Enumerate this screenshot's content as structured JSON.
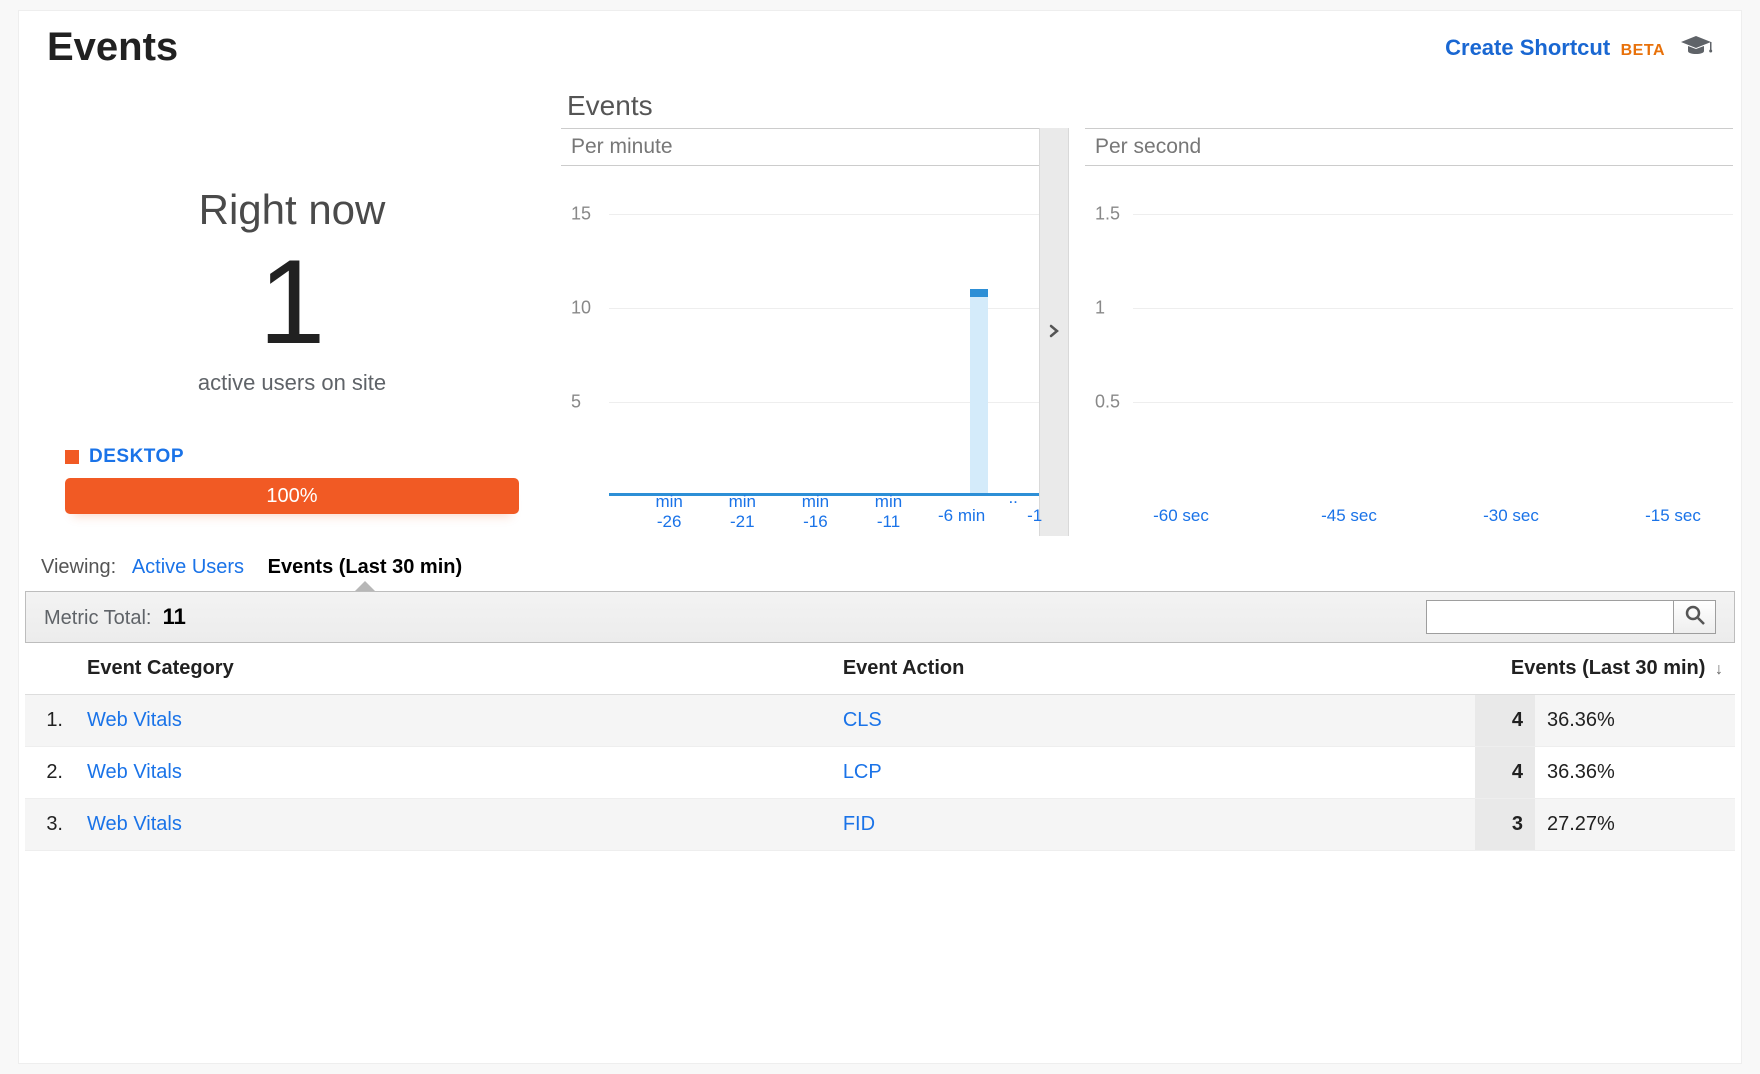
{
  "header": {
    "title": "Events",
    "shortcut_label": "Create Shortcut",
    "beta_label": "BETA"
  },
  "rightnow": {
    "title": "Right now",
    "value": "1",
    "subtitle": "active users on site",
    "device_label": "DESKTOP",
    "device_percent": "100%"
  },
  "events_section_title": "Events",
  "per_minute_label": "Per minute",
  "per_second_label": "Per second",
  "viewing": {
    "label": "Viewing:",
    "active_users": "Active Users",
    "events_last_30": "Events (Last 30 min)"
  },
  "metric": {
    "label": "Metric Total:",
    "value": "11"
  },
  "table": {
    "headers": {
      "category": "Event Category",
      "action": "Event Action",
      "events": "Events (Last 30 min)"
    },
    "rows": [
      {
        "idx": "1.",
        "category": "Web Vitals",
        "action": "CLS",
        "count": "4",
        "pct": "36.36%"
      },
      {
        "idx": "2.",
        "category": "Web Vitals",
        "action": "LCP",
        "count": "4",
        "pct": "36.36%"
      },
      {
        "idx": "3.",
        "category": "Web Vitals",
        "action": "FID",
        "count": "3",
        "pct": "27.27%"
      }
    ]
  },
  "chart_data": [
    {
      "type": "bar",
      "title": "Per minute",
      "ylabel": "",
      "ylim": [
        0,
        17
      ],
      "yticks": [
        5,
        10,
        15
      ],
      "categories": [
        "min -26",
        "min -21",
        "min -16",
        "min -11",
        "-6 min",
        "..",
        "-1"
      ],
      "highlight_bar": {
        "x": "-6 min",
        "value": 11
      },
      "values": []
    },
    {
      "type": "bar",
      "title": "Per second",
      "ylabel": "",
      "ylim": [
        0,
        1.7
      ],
      "yticks": [
        0.5,
        1,
        1.5
      ],
      "categories": [
        "-60 sec",
        "-45 sec",
        "-30 sec",
        "-15 sec"
      ],
      "values": []
    }
  ]
}
